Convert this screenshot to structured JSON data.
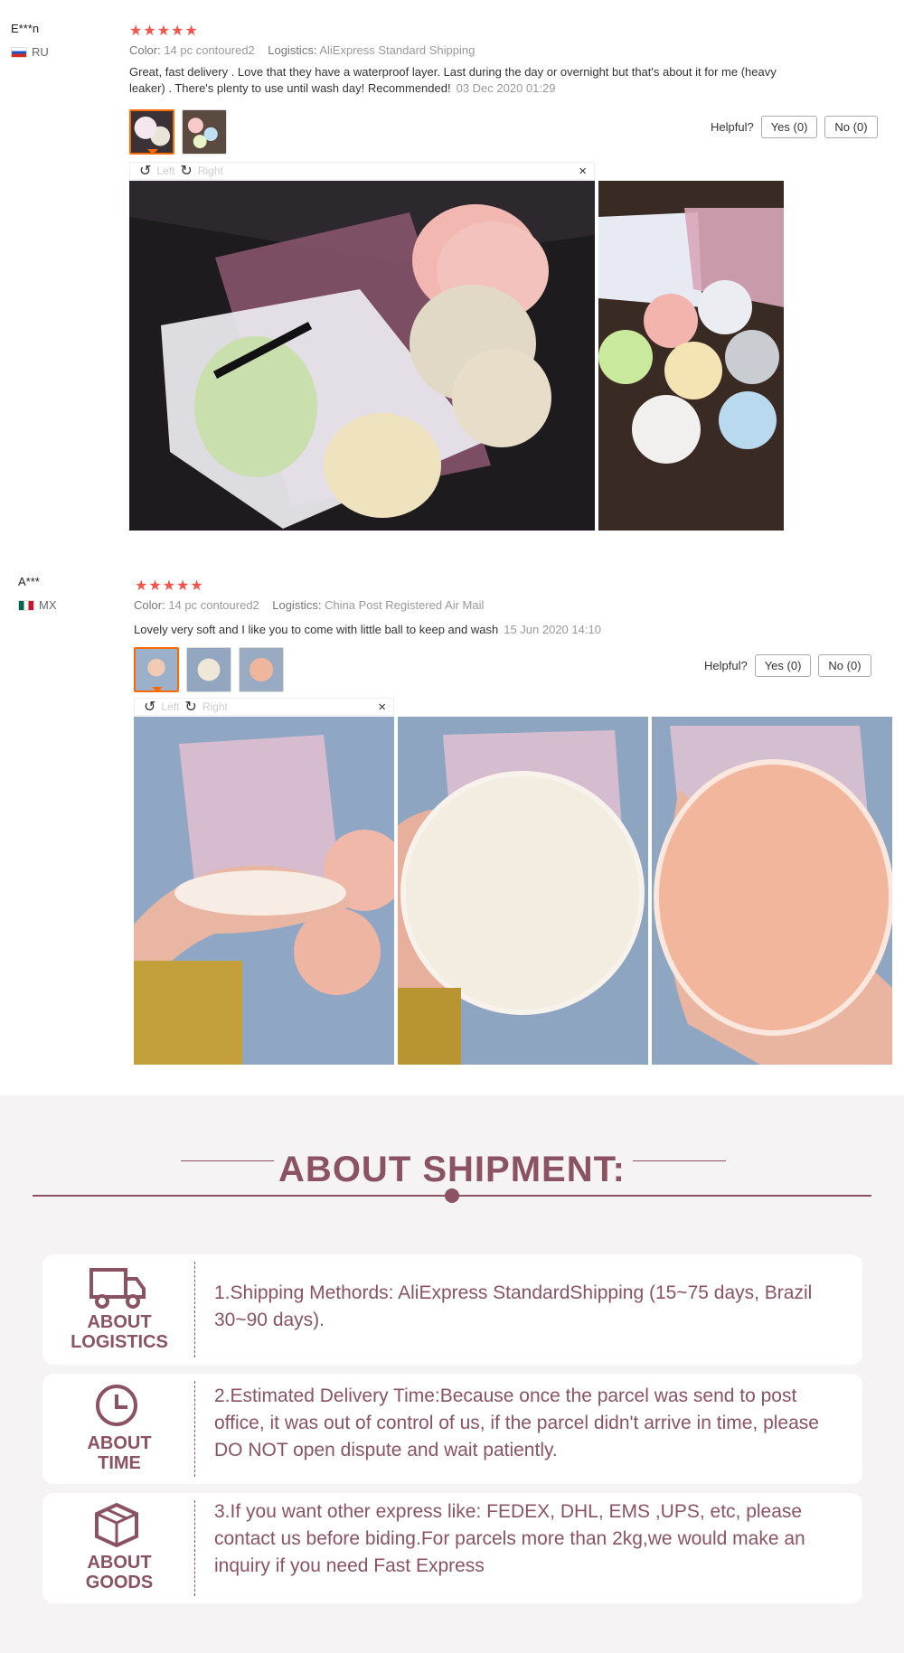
{
  "reviews": [
    {
      "user": "E***n",
      "country": "RU",
      "stars": "★★★★★",
      "color_label": "Color:",
      "color_value": "14 pc contoured2",
      "logistics_label": "Logistics:",
      "logistics_value": "AliExpress Standard Shipping",
      "text": "Great, fast delivery . Love that they have a waterproof layer. Last during the day or overnight but that's about it for me (heavy leaker) . There's plenty to use until wash day! Recommended!",
      "date": "03 Dec 2020 01:29",
      "helpful_label": "Helpful?",
      "yes_label": "Yes (0)",
      "no_label": "No (0)",
      "viewer_left": "Left",
      "viewer_right": "Right",
      "close": "×"
    },
    {
      "user": "A***",
      "country": "MX",
      "stars": "★★★★★",
      "color_label": "Color:",
      "color_value": "14 pc contoured2",
      "logistics_label": "Logistics:",
      "logistics_value": "China Post Registered Air Mail",
      "text": "Lovely very soft and I like you to come with little ball to keep and wash",
      "date": "15 Jun 2020 14:10",
      "helpful_label": "Helpful?",
      "yes_label": "Yes (0)",
      "no_label": "No (0)",
      "viewer_left": "Left",
      "viewer_right": "Right",
      "close": "×"
    }
  ],
  "shipment": {
    "title": "ABOUT SHIPMENT:",
    "cards": [
      {
        "icon": "truck-icon",
        "label_line1": "ABOUT",
        "label_line2": "LOGISTICS",
        "desc": "1.Shipping Methords: AliExpress StandardShipping (15~75 days, Brazil 30~90 days)."
      },
      {
        "icon": "clock-icon",
        "label_line1": "ABOUT",
        "label_line2": "TIME",
        "desc": "2.Estimated Delivery Time:Because once the parcel was send to post office, it was out of control of us, if the parcel didn't arrive in time, please DO NOT open dispute and wait patiently."
      },
      {
        "icon": "box-icon",
        "label_line1": "ABOUT",
        "label_line2": "GOODS",
        "desc": "3.If you want other express like: FEDEX, DHL, EMS ,UPS, etc, please contact us before biding.For parcels more than 2kg,we would make an inquiry if you need Fast Express"
      }
    ]
  },
  "colors": {
    "accent": "#8b5264",
    "star": "#f2554c",
    "thumb_active": "#ff6a00"
  }
}
